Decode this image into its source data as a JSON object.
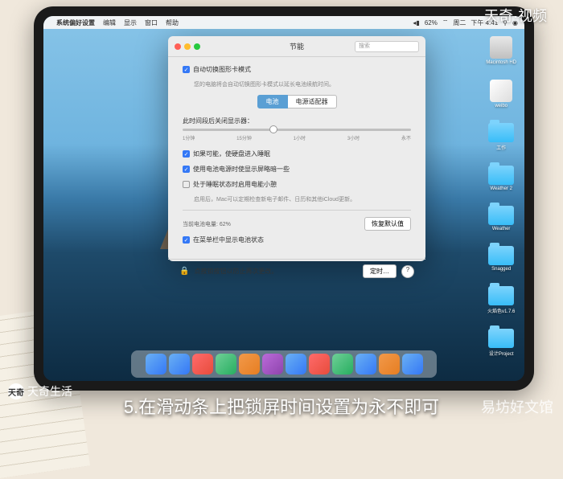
{
  "watermarks": {
    "top_right": "天奇·视频",
    "bottom_left_logo": "天奇",
    "bottom_left_text": "天奇生活",
    "bottom_right": "易坊好文馆"
  },
  "caption": "5.在滑动条上把锁屏时间设置为永不即可",
  "menubar": {
    "apple": "",
    "app": "系统偏好设置",
    "items": [
      "编辑",
      "显示",
      "窗口",
      "帮助"
    ],
    "status": {
      "battery": "62%",
      "day": "周二",
      "time": "下午 4:41"
    }
  },
  "prefs": {
    "title": "节能",
    "search_placeholder": "搜索",
    "opt1": {
      "label": "自动切换图形卡模式",
      "desc": "您的电脑将会自动切换图形卡模式以延长电池续航时间。"
    },
    "tabs": {
      "battery": "电池",
      "adapter": "电源适配器"
    },
    "slider": {
      "label": "此时间段后关闭显示器：",
      "ticks": [
        "1分钟",
        "15分钟",
        "1小时",
        "3小时",
        "永不"
      ]
    },
    "checks": {
      "c1": "如果可能，使硬盘进入睡眠",
      "c2": "使用电池电源时使显示屏略暗一些",
      "c3": "处于睡眠状态时启用电能小憩",
      "c3_desc": "启用后，Mac可以定期检查新电子邮件、日历和其他iCloud更新。",
      "c4": "在菜单栏中显示电池状态"
    },
    "battery_status": "当前电池电量: 62%",
    "restore_btn": "恢复默认值",
    "lock_text": "点按锁按钮以防止再次更改。",
    "schedule_btn": "定时…",
    "help": "?"
  },
  "desktop": {
    "items": [
      "Macintosh HD",
      "weibo",
      "工作",
      "Weather 2",
      "Weather",
      "Snagged",
      "火焰色v1.7.6",
      "设计Project"
    ]
  }
}
